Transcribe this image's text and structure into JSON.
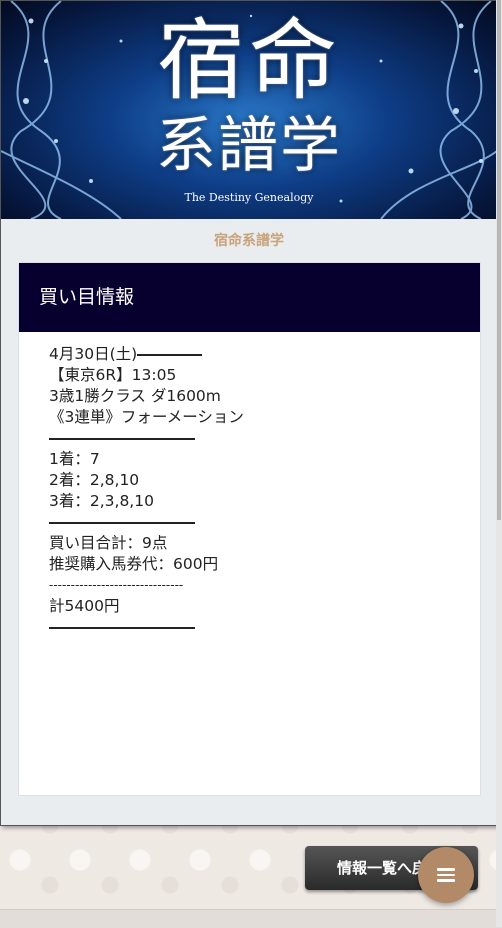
{
  "banner": {
    "title_line1": "宿命",
    "title_line2": "系譜学",
    "subtitle": "The Destiny Genealogy"
  },
  "site_name": "宿命系譜学",
  "card": {
    "header": "買い目情報",
    "lines": {
      "date": "4月30日(土)",
      "race": "【東京6R】13:05",
      "cls": "3歳1勝クラス ダ1600m",
      "bet_type": "《3連単》フォーメーション",
      "first": "1着：7",
      "second": "2着：2,8,10",
      "third": "3着：2,3,8,10",
      "total_points": "買い目合計：9点",
      "recommend": "推奨購入馬券代：600円",
      "dash": "-------------------------------",
      "total": "計5400円"
    }
  },
  "footer": {
    "list_button": "情報一覧へ戻る"
  },
  "colors": {
    "header_bg": "#07002f",
    "accent": "#c8a37c",
    "fab_bg": "#b28a67"
  },
  "icons": {
    "fab": "menu-icon"
  }
}
